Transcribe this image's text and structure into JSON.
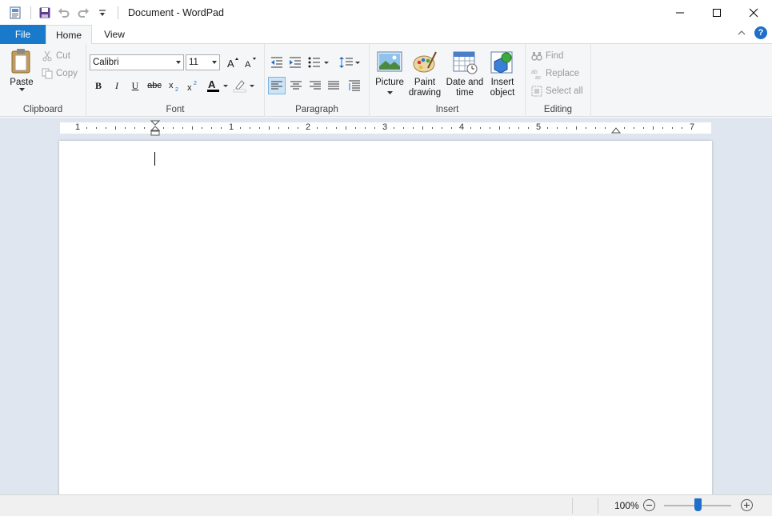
{
  "window": {
    "title": "Document - WordPad",
    "icons": [
      "wordpad-app-icon",
      "save-icon",
      "undo-icon",
      "redo-icon",
      "customize-qat-icon",
      "minimize-icon",
      "maximize-icon",
      "close-icon"
    ]
  },
  "tabs": {
    "file": "File",
    "home": "Home",
    "view": "View"
  },
  "help": {
    "glyph": "?"
  },
  "clipboard": {
    "paste": "Paste",
    "cut": "Cut",
    "copy": "Copy",
    "label": "Clipboard"
  },
  "font": {
    "family": "Calibri",
    "size": "11",
    "bold": "B",
    "italic": "I",
    "underline": "U",
    "strikethrough": "abc",
    "label": "Font"
  },
  "paragraph": {
    "label": "Paragraph"
  },
  "insert": {
    "picture": "Picture",
    "paint_line1": "Paint",
    "paint_line2": "drawing",
    "date_line1": "Date and",
    "date_line2": "time",
    "object_line1": "Insert",
    "object_line2": "object",
    "label": "Insert"
  },
  "editing": {
    "find": "Find",
    "replace": "Replace",
    "select_all": "Select all",
    "label": "Editing"
  },
  "ruler": {
    "numbers": [
      "1",
      "1",
      "2",
      "3",
      "4",
      "5",
      "7"
    ]
  },
  "status": {
    "zoom": "100%",
    "zoom_level": 0.5
  },
  "colors": {
    "accent": "#1979ca",
    "font_color": "#000000",
    "highlight": "#ffffff"
  }
}
